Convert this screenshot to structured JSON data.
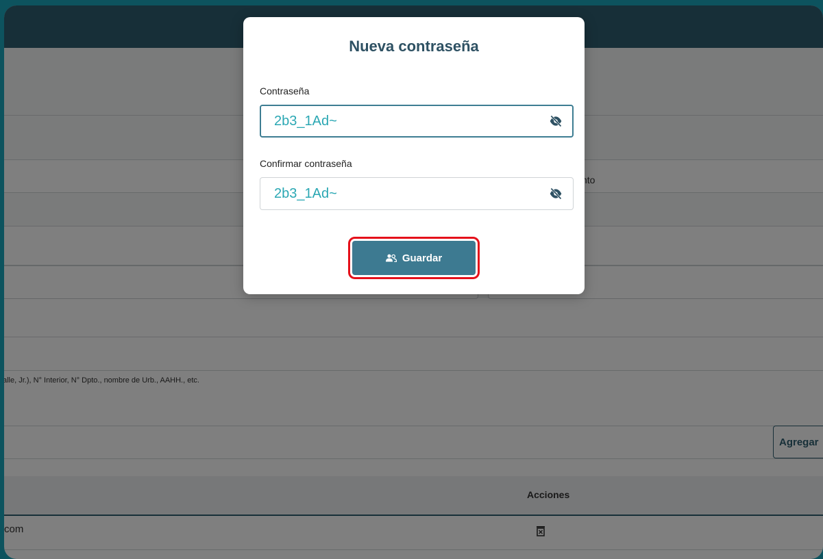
{
  "background": {
    "partial_label": "nto",
    "address_hint": "alle, Jr.), N° Interior, N° Dpto., nombre de Urb., AAHH., etc.",
    "add_button_label": "Agregar",
    "table": {
      "actions_header": "Acciones",
      "row_email_partial": "com"
    }
  },
  "modal": {
    "title": "Nueva contraseña",
    "password_label": "Contraseña",
    "password_value": "2b3_1Ad~",
    "confirm_label": "Confirmar contraseña",
    "confirm_value": "2b3_1Ad~",
    "save_label": "Guardar",
    "icons": {
      "toggle_visibility": "eye-off-icon",
      "save": "users-icon"
    }
  },
  "colors": {
    "header": "#2e5f70",
    "accent": "#3d7a91",
    "input_text": "#2aa7b3",
    "highlight": "#e5101a",
    "page_background": "#1aa6bd"
  }
}
